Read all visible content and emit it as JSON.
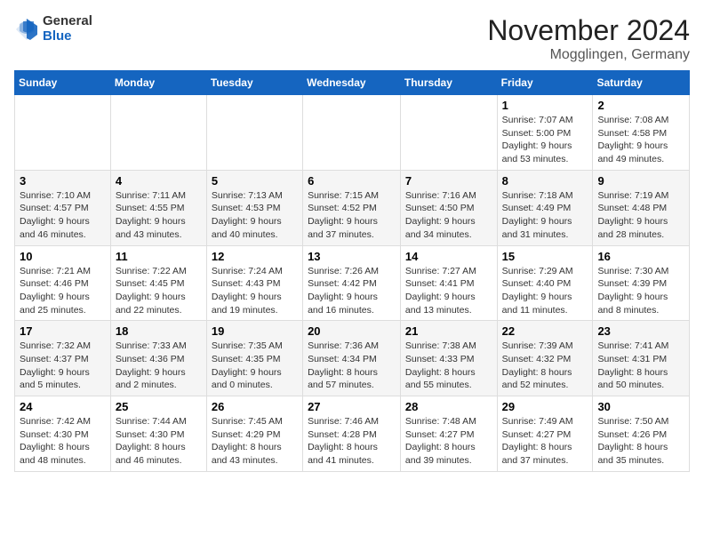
{
  "logo": {
    "general": "General",
    "blue": "Blue"
  },
  "title": "November 2024",
  "location": "Mogglingen, Germany",
  "days_header": [
    "Sunday",
    "Monday",
    "Tuesday",
    "Wednesday",
    "Thursday",
    "Friday",
    "Saturday"
  ],
  "weeks": [
    [
      {
        "day": "",
        "info": ""
      },
      {
        "day": "",
        "info": ""
      },
      {
        "day": "",
        "info": ""
      },
      {
        "day": "",
        "info": ""
      },
      {
        "day": "",
        "info": ""
      },
      {
        "day": "1",
        "info": "Sunrise: 7:07 AM\nSunset: 5:00 PM\nDaylight: 9 hours and 53 minutes."
      },
      {
        "day": "2",
        "info": "Sunrise: 7:08 AM\nSunset: 4:58 PM\nDaylight: 9 hours and 49 minutes."
      }
    ],
    [
      {
        "day": "3",
        "info": "Sunrise: 7:10 AM\nSunset: 4:57 PM\nDaylight: 9 hours and 46 minutes."
      },
      {
        "day": "4",
        "info": "Sunrise: 7:11 AM\nSunset: 4:55 PM\nDaylight: 9 hours and 43 minutes."
      },
      {
        "day": "5",
        "info": "Sunrise: 7:13 AM\nSunset: 4:53 PM\nDaylight: 9 hours and 40 minutes."
      },
      {
        "day": "6",
        "info": "Sunrise: 7:15 AM\nSunset: 4:52 PM\nDaylight: 9 hours and 37 minutes."
      },
      {
        "day": "7",
        "info": "Sunrise: 7:16 AM\nSunset: 4:50 PM\nDaylight: 9 hours and 34 minutes."
      },
      {
        "day": "8",
        "info": "Sunrise: 7:18 AM\nSunset: 4:49 PM\nDaylight: 9 hours and 31 minutes."
      },
      {
        "day": "9",
        "info": "Sunrise: 7:19 AM\nSunset: 4:48 PM\nDaylight: 9 hours and 28 minutes."
      }
    ],
    [
      {
        "day": "10",
        "info": "Sunrise: 7:21 AM\nSunset: 4:46 PM\nDaylight: 9 hours and 25 minutes."
      },
      {
        "day": "11",
        "info": "Sunrise: 7:22 AM\nSunset: 4:45 PM\nDaylight: 9 hours and 22 minutes."
      },
      {
        "day": "12",
        "info": "Sunrise: 7:24 AM\nSunset: 4:43 PM\nDaylight: 9 hours and 19 minutes."
      },
      {
        "day": "13",
        "info": "Sunrise: 7:26 AM\nSunset: 4:42 PM\nDaylight: 9 hours and 16 minutes."
      },
      {
        "day": "14",
        "info": "Sunrise: 7:27 AM\nSunset: 4:41 PM\nDaylight: 9 hours and 13 minutes."
      },
      {
        "day": "15",
        "info": "Sunrise: 7:29 AM\nSunset: 4:40 PM\nDaylight: 9 hours and 11 minutes."
      },
      {
        "day": "16",
        "info": "Sunrise: 7:30 AM\nSunset: 4:39 PM\nDaylight: 9 hours and 8 minutes."
      }
    ],
    [
      {
        "day": "17",
        "info": "Sunrise: 7:32 AM\nSunset: 4:37 PM\nDaylight: 9 hours and 5 minutes."
      },
      {
        "day": "18",
        "info": "Sunrise: 7:33 AM\nSunset: 4:36 PM\nDaylight: 9 hours and 2 minutes."
      },
      {
        "day": "19",
        "info": "Sunrise: 7:35 AM\nSunset: 4:35 PM\nDaylight: 9 hours and 0 minutes."
      },
      {
        "day": "20",
        "info": "Sunrise: 7:36 AM\nSunset: 4:34 PM\nDaylight: 8 hours and 57 minutes."
      },
      {
        "day": "21",
        "info": "Sunrise: 7:38 AM\nSunset: 4:33 PM\nDaylight: 8 hours and 55 minutes."
      },
      {
        "day": "22",
        "info": "Sunrise: 7:39 AM\nSunset: 4:32 PM\nDaylight: 8 hours and 52 minutes."
      },
      {
        "day": "23",
        "info": "Sunrise: 7:41 AM\nSunset: 4:31 PM\nDaylight: 8 hours and 50 minutes."
      }
    ],
    [
      {
        "day": "24",
        "info": "Sunrise: 7:42 AM\nSunset: 4:30 PM\nDaylight: 8 hours and 48 minutes."
      },
      {
        "day": "25",
        "info": "Sunrise: 7:44 AM\nSunset: 4:30 PM\nDaylight: 8 hours and 46 minutes."
      },
      {
        "day": "26",
        "info": "Sunrise: 7:45 AM\nSunset: 4:29 PM\nDaylight: 8 hours and 43 minutes."
      },
      {
        "day": "27",
        "info": "Sunrise: 7:46 AM\nSunset: 4:28 PM\nDaylight: 8 hours and 41 minutes."
      },
      {
        "day": "28",
        "info": "Sunrise: 7:48 AM\nSunset: 4:27 PM\nDaylight: 8 hours and 39 minutes."
      },
      {
        "day": "29",
        "info": "Sunrise: 7:49 AM\nSunset: 4:27 PM\nDaylight: 8 hours and 37 minutes."
      },
      {
        "day": "30",
        "info": "Sunrise: 7:50 AM\nSunset: 4:26 PM\nDaylight: 8 hours and 35 minutes."
      }
    ]
  ]
}
